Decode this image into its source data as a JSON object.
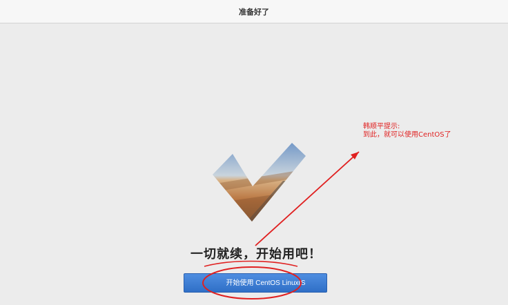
{
  "header": {
    "title": "准备好了"
  },
  "main": {
    "headline": "一切就续，开始用吧！",
    "start_button": {
      "label": "开始使用 CentOS Linux(S"
    }
  },
  "annotation": {
    "line1": "韩顺平提示:",
    "line2": "到此，就可以使用CentOS了",
    "color": "#e02020"
  },
  "icons": {
    "checkmark": "checkmark-icon"
  }
}
